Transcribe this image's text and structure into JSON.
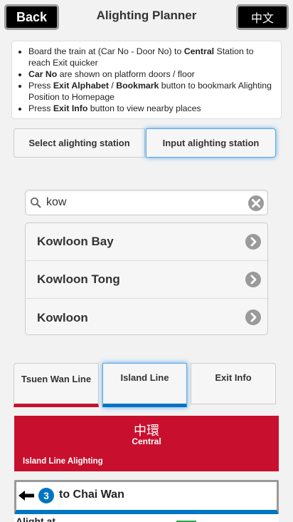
{
  "header": {
    "back_label": "Back",
    "title": "Alighting Planner",
    "lang_label": "中文"
  },
  "notes": [
    {
      "parts": [
        {
          "t": "Board the train at (Car No - Door No) to ",
          "b": false
        },
        {
          "t": "Central",
          "b": true
        },
        {
          "t": " Station to reach Exit quicker",
          "b": false
        }
      ]
    },
    {
      "parts": [
        {
          "t": "Car No",
          "b": true
        },
        {
          "t": " are shown on platform doors / floor",
          "b": false
        }
      ]
    },
    {
      "parts": [
        {
          "t": "Press ",
          "b": false
        },
        {
          "t": "Exit Alphabet",
          "b": true
        },
        {
          "t": " / ",
          "b": false
        },
        {
          "t": "Bookmark",
          "b": true
        },
        {
          "t": " button to bookmark Alighting Position to Homepage",
          "b": false
        }
      ]
    },
    {
      "parts": [
        {
          "t": "Press ",
          "b": false
        },
        {
          "t": "Exit Info",
          "b": true
        },
        {
          "t": " button to view nearby places",
          "b": false
        }
      ]
    }
  ],
  "mode_tabs": {
    "select_label": "Select alighting station",
    "input_label": "Input alighting station"
  },
  "search": {
    "value": "kow",
    "placeholder": ""
  },
  "results": [
    "Kowloon Bay",
    "Kowloon Tong",
    "Kowloon"
  ],
  "line_tabs": {
    "tsuen_wan_label": "Tsuen Wan Line",
    "island_label": "Island Line",
    "exit_info_label": "Exit Info"
  },
  "station": {
    "name_zh": "中環",
    "name_en": "Central",
    "subtitle": "Island Line Alighting"
  },
  "direction": {
    "number": "3",
    "destination": "to Chai Wan"
  },
  "alight": {
    "label": "Alight at"
  },
  "colors": {
    "island_line": "#0075c2",
    "tsuen_wan_line": "#c8102e",
    "exit_green": "#2aa84a"
  }
}
